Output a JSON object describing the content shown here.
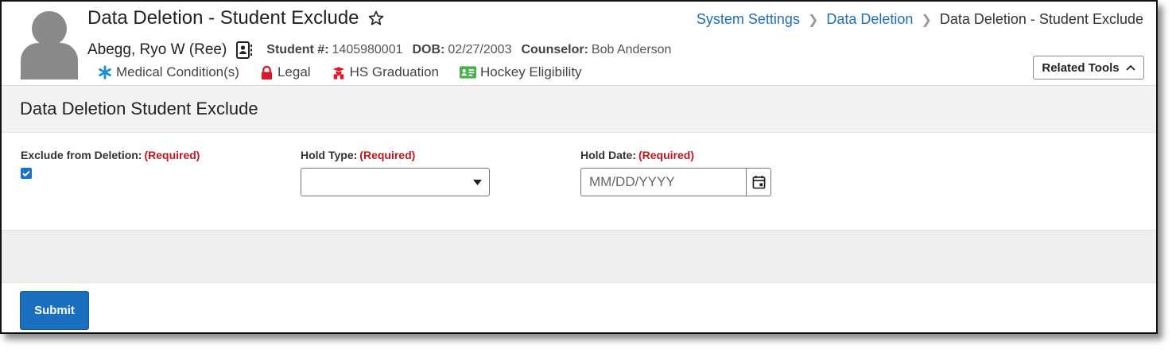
{
  "header": {
    "page_title": "Data Deletion - Student Exclude",
    "breadcrumb": {
      "items": [
        "System Settings",
        "Data Deletion"
      ],
      "current": "Data Deletion - Student Exclude"
    },
    "student": {
      "name": "Abegg, Ryo W (Ree)",
      "student_number_label": "Student #:",
      "student_number": "1405980001",
      "dob_label": "DOB:",
      "dob": "02/27/2003",
      "counselor_label": "Counselor:",
      "counselor": "Bob Anderson"
    },
    "flags": [
      {
        "label": "Medical Condition(s)",
        "icon": "asterisk-icon",
        "color": "#1a8fd8"
      },
      {
        "label": "Legal",
        "icon": "lock-icon",
        "color": "#d9182a"
      },
      {
        "label": "HS Graduation",
        "icon": "graduation-cap-icon",
        "color": "#d9182a"
      },
      {
        "label": "Hockey Eligibility",
        "icon": "id-card-icon",
        "color": "#4caf50"
      }
    ],
    "related_tools_label": "Related Tools"
  },
  "section": {
    "title": "Data Deletion Student Exclude"
  },
  "form": {
    "exclude": {
      "label": "Exclude from Deletion:",
      "required": "(Required)",
      "checked": true
    },
    "hold_type": {
      "label": "Hold Type:",
      "required": "(Required)",
      "value": ""
    },
    "hold_date": {
      "label": "Hold Date:",
      "required": "(Required)",
      "placeholder": "MM/DD/YYYY",
      "value": ""
    }
  },
  "actions": {
    "submit_label": "Submit"
  },
  "colors": {
    "link": "#1d6fb8",
    "required": "#c0161d",
    "primary_button": "#1a6fbe"
  }
}
